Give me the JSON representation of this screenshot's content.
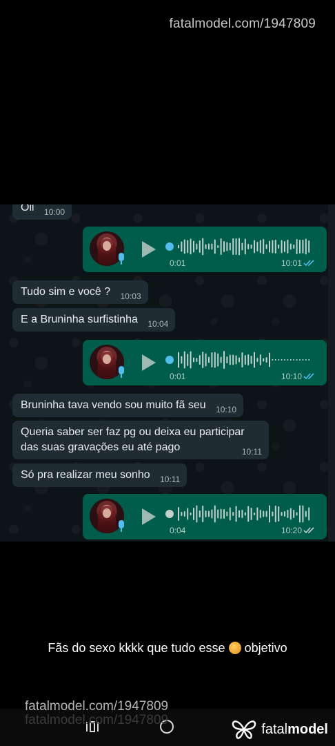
{
  "watermark": {
    "text": "fatalmodel.com/1947809"
  },
  "chat": {
    "messages": [
      {
        "type": "in",
        "text": "Oii",
        "time": "10:00"
      },
      {
        "type": "audio",
        "duration": "0:01",
        "time": "10:01",
        "status": "read"
      },
      {
        "type": "in",
        "text": "Tudo sim e você ?",
        "time": "10:03"
      },
      {
        "type": "in",
        "text": "E a Bruninha surfistinha",
        "time": "10:04"
      },
      {
        "type": "audio",
        "duration": "0:01",
        "time": "10:10",
        "status": "read"
      },
      {
        "type": "in",
        "text": "Bruninha tava vendo sou muito fã seu",
        "time": "10:10"
      },
      {
        "type": "in",
        "text": "Queria saber ser faz pg ou deixa eu participar das suas gravações eu até pago",
        "time": "10:11"
      },
      {
        "type": "in",
        "text": "Só pra realizar meu sonho",
        "time": "10:11"
      },
      {
        "type": "audio",
        "duration": "0:04",
        "time": "10:20",
        "status": "delivered"
      }
    ]
  },
  "caption": {
    "text": "Fãs do sexo kkkk que tudo esse",
    "text_after": "objetivo"
  },
  "brand": {
    "name_light": "fatal",
    "name_bold": "model"
  },
  "colors": {
    "incoming_bubble": "#202c33",
    "outgoing_bubble": "#005c4b",
    "read_ticks": "#53bdeb",
    "chat_background": "#0d1418"
  },
  "icons": [
    "microphone-icon",
    "play-icon",
    "double-check-icon",
    "recents-icon",
    "home-icon",
    "butterfly-logo-icon"
  ]
}
